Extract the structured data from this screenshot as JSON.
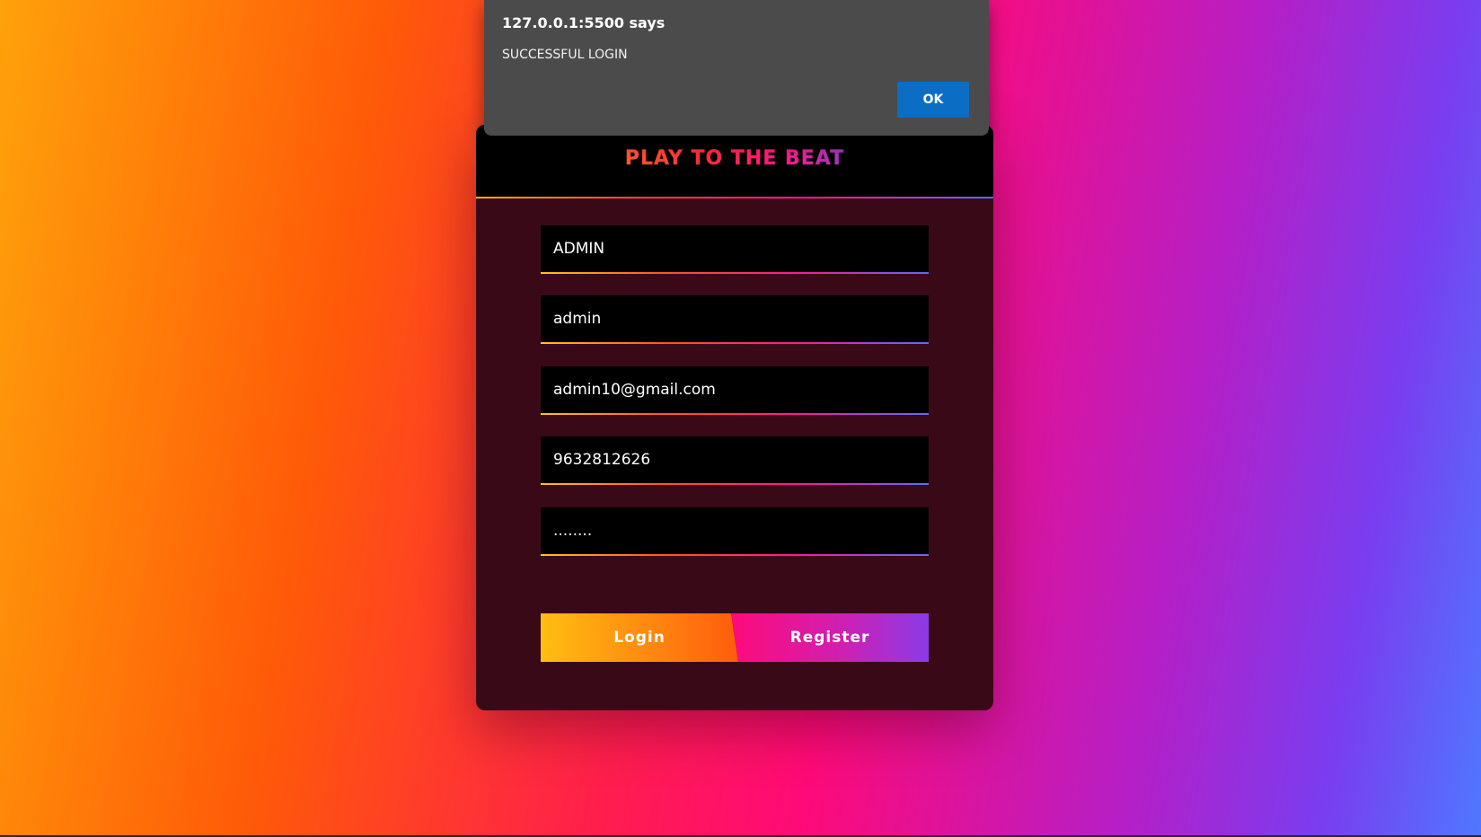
{
  "brand": {
    "title": "PLAY TO THE BEAT"
  },
  "form": {
    "fields": [
      {
        "value": "ADMIN"
      },
      {
        "value": "admin"
      },
      {
        "value": "admin10@gmail.com"
      },
      {
        "value": "9632812626"
      },
      {
        "value": "........"
      }
    ],
    "login_label": "Login",
    "register_label": "Register"
  },
  "alert": {
    "origin": "127.0.0.1:5500 says",
    "message": "SUCCESSFUL LOGIN",
    "ok_label": "OK"
  },
  "colors": {
    "accent_orange": "#ff5c0c",
    "accent_pink": "#ff0a7a",
    "accent_purple": "#8a3be8",
    "card_bg": "#3a0918",
    "dialog_button": "#0b6dc4"
  }
}
